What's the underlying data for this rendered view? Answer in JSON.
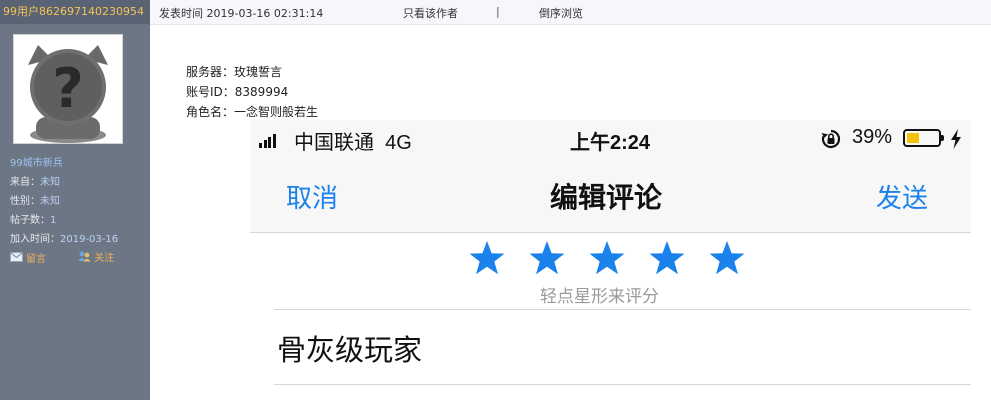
{
  "sidebar": {
    "username": "99用户862697140230954",
    "level": "99城市新兵",
    "from_label": "来自：",
    "from_value": "未知",
    "gender_label": "性别：",
    "gender_value": "未知",
    "posts_label": "帖子数：",
    "posts_value": "1",
    "joined_label": "加入时间：",
    "joined_value": "2019-03-16",
    "message_label": "留言",
    "follow_label": "关注"
  },
  "header": {
    "post_time": "发表时间 2019-03-16 02:31:14",
    "only_author": "只看该作者",
    "separator": "|",
    "reverse": "倒序浏览"
  },
  "post_meta": {
    "server": "服务器：玫瑰誓言",
    "account": "账号ID：8389994",
    "role": "角色名：一念智则般若生"
  },
  "phone": {
    "carrier": "中国联通",
    "network": "4G",
    "time": "上午2:24",
    "battery_pct": "39%",
    "battery_level": 0.39,
    "cancel": "取消",
    "title": "编辑评论",
    "send": "发送",
    "star_count": 5,
    "rating_hint": "轻点星形来评分",
    "comment": "骨灰级玩家",
    "accent_color": "#1a82ea",
    "battery_color": "#f4c20d"
  }
}
